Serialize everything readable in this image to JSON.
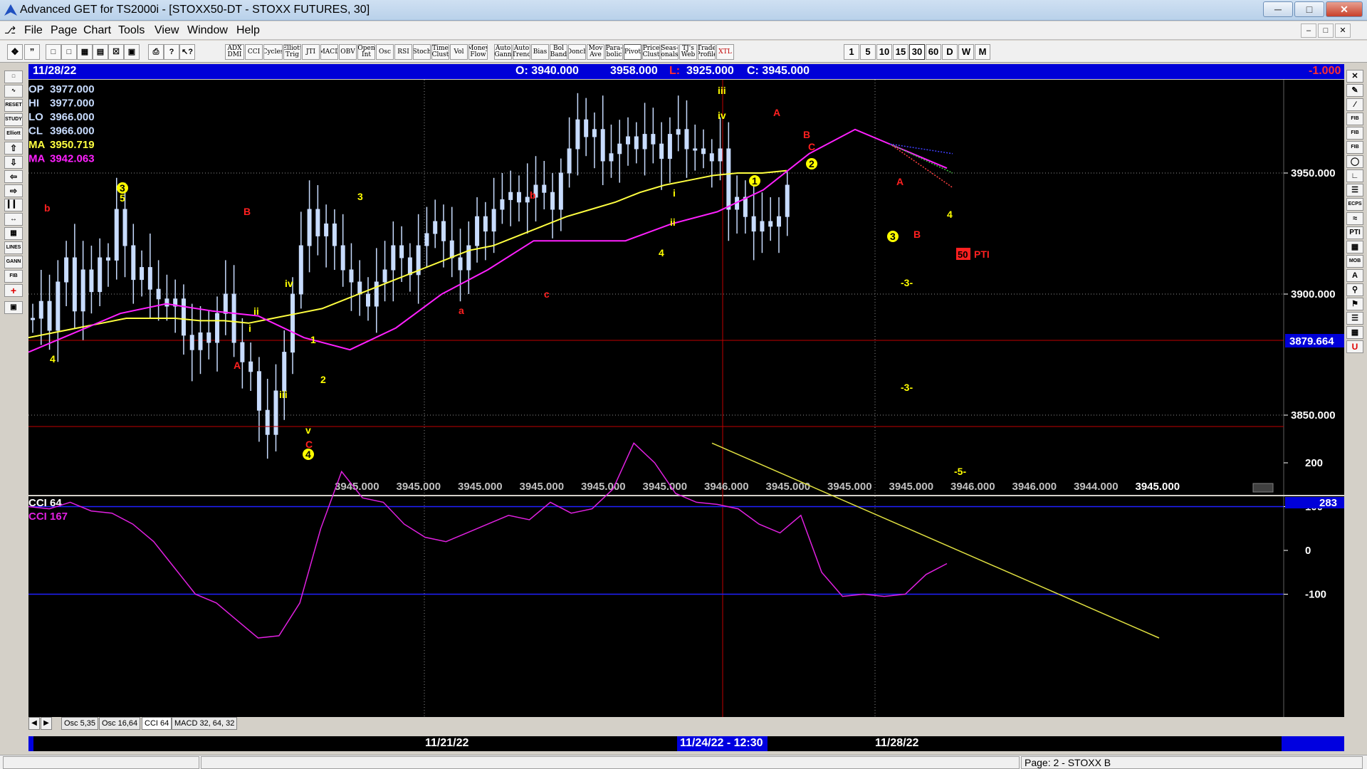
{
  "window": {
    "title": "Advanced GET for TS2000i - [STOXX50-DT - STOXX FUTURES, 30]"
  },
  "menu": [
    "File",
    "Page",
    "Chart",
    "Tools",
    "View",
    "Window",
    "Help"
  ],
  "toolbar": {
    "studies": [
      "ADX DMI",
      "CCI",
      "Cycles",
      "Elliott Trig",
      "JTI",
      "MACD",
      "OBV",
      "Open Int",
      "Osc",
      "RSI",
      "Stoch",
      "Time Clust",
      "Vol",
      "Money Flow",
      "Auto Gann",
      "Auto Trend",
      "Bias",
      "Bol Band",
      "Donch",
      "Mov Ave",
      "Para-bolic",
      "Pivot",
      "Price Clust",
      "Seas-onals",
      "TJ's Web",
      "Trade Profile",
      "XTL"
    ],
    "timeframes": [
      "1",
      "5",
      "10",
      "15",
      "30",
      "60",
      "D",
      "W",
      "M"
    ],
    "active_timeframe": "30"
  },
  "left_tools": [
    "RESET",
    "STUDY",
    "Elliott",
    "LINES",
    "GANN",
    "FIB"
  ],
  "right_tools": [
    "FIB RET",
    "FIB EXT",
    "FIB TIME",
    "ECPS",
    "PTI",
    "MOB",
    "U"
  ],
  "header": {
    "date": "11/28/22",
    "open": "O: 3940.000",
    "high": "3958.000",
    "low_label": "L:",
    "low": "3925.000",
    "close": "C: 3945.000",
    "change": "-1.000"
  },
  "readout": [
    {
      "label": "OP",
      "value": "3977.000"
    },
    {
      "label": "HI",
      "value": "3977.000"
    },
    {
      "label": "LO",
      "value": "3966.000"
    },
    {
      "label": "CL",
      "value": "3966.000"
    },
    {
      "label": "MA",
      "value": "3950.719"
    },
    {
      "label": "MA",
      "value": "3942.063"
    }
  ],
  "price_axis": {
    "ticks": [
      "3950.000",
      "3900.000",
      "3850.000"
    ],
    "cursor_price": "3879.664"
  },
  "bottom_values": [
    "3945.000",
    "3945.000",
    "3945.000",
    "3945.000",
    "3945.000",
    "3945.000",
    "3946.000",
    "3945.000",
    "3945.000",
    "3945.000",
    "3946.000",
    "3946.000",
    "3944.000",
    "3945.000"
  ],
  "indicator": {
    "title1": "CCI 64",
    "title2": "CCI  167",
    "value": "283",
    "ticks": [
      "200",
      "100",
      "0",
      "-100"
    ]
  },
  "tabs": [
    "Osc 5,35",
    "Osc 16,64",
    "CCI 64",
    "MACD 32, 64, 32"
  ],
  "active_tab": "CCI 64",
  "dates": [
    "11/21/22",
    "11/24/22 - 12:30",
    "11/28/22"
  ],
  "status": {
    "page": "Page: 2 - STOXX B"
  },
  "colors": {
    "bg": "#000000",
    "candle": "#c8dcff",
    "ma_fast": "#ffff40",
    "ma_slow": "#ff20ff",
    "bull_label": "#ffff00",
    "bear_label": "#ff2020",
    "header": "#0000d8",
    "cci": "#e020e0",
    "trendline": "#e0e040"
  },
  "chart_data": {
    "type": "candlestick",
    "title": "STOXX50-DT - STOXX FUTURES, 30",
    "ylim": [
      3810,
      3985
    ],
    "close_series": [
      3890,
      3897,
      3885,
      3905,
      3915,
      3893,
      3910,
      3901,
      3915,
      3914,
      3935,
      3920,
      3906,
      3911,
      3902,
      3898,
      3895,
      3898,
      3883,
      3877,
      3884,
      3880,
      3892,
      3900,
      3880,
      3872,
      3868,
      3852,
      3842,
      3860,
      3876,
      3900,
      3920,
      3935,
      3924,
      3929,
      3920,
      3910,
      3905,
      3900,
      3895,
      3905,
      3910,
      3920,
      3915,
      3908,
      3920,
      3925,
      3930,
      3922,
      3915,
      3910,
      3920,
      3932,
      3926,
      3935,
      3939,
      3942,
      3938,
      3940,
      3945,
      3942,
      3935,
      3950,
      3960,
      3972,
      3965,
      3968,
      3955,
      3958,
      3962,
      3965,
      3960,
      3966,
      3962,
      3956,
      3966,
      3968,
      3960,
      3960,
      3958,
      3955,
      3960,
      3935,
      3940,
      3932,
      3926,
      3930,
      3928,
      3932,
      3945
    ],
    "ma_fast": [
      3882,
      3884,
      3886,
      3888,
      3890,
      3890,
      3890,
      3889,
      3889,
      3888,
      3890,
      3892,
      3894,
      3898,
      3902,
      3906,
      3910,
      3914,
      3918,
      3920,
      3924,
      3928,
      3932,
      3935,
      3938,
      3942,
      3945,
      3947,
      3949,
      3950,
      3950,
      3951
    ],
    "ma_slow": [
      3876,
      3884,
      3892,
      3896,
      3893,
      3891,
      3882,
      3877,
      3886,
      3900,
      3910,
      3922,
      3922,
      3922,
      3929,
      3934,
      3943,
      3958,
      3968,
      3960,
      3952
    ],
    "cci": [
      100,
      95,
      110,
      90,
      85,
      60,
      20,
      -40,
      -100,
      -120,
      -160,
      -200,
      -195,
      -120,
      50,
      180,
      120,
      110,
      60,
      30,
      20,
      40,
      60,
      80,
      70,
      110,
      85,
      95,
      140,
      245,
      200,
      130,
      110,
      105,
      95,
      60,
      40,
      80,
      -50,
      -105,
      -100,
      -105,
      -100,
      -55,
      -30
    ],
    "waves": [
      {
        "label": "b",
        "color": "bear"
      },
      {
        "label": "3",
        "color": "bull"
      },
      {
        "label": "5",
        "color": "bull"
      },
      {
        "label": "4",
        "color": "bull"
      },
      {
        "label": "B",
        "color": "bear"
      },
      {
        "label": "A",
        "color": "bear"
      },
      {
        "label": "ii",
        "color": "bull"
      },
      {
        "label": "i",
        "color": "bull"
      },
      {
        "label": "iv",
        "color": "bull"
      },
      {
        "label": "iii",
        "color": "bull"
      },
      {
        "label": "1",
        "color": "bull"
      },
      {
        "label": "2",
        "color": "bull"
      },
      {
        "label": "v",
        "color": "bull"
      },
      {
        "label": "C",
        "color": "bear"
      },
      {
        "label": "4",
        "color": "bull"
      },
      {
        "label": "3",
        "color": "bull"
      },
      {
        "label": "b",
        "color": "bear"
      },
      {
        "label": "a",
        "color": "bear"
      },
      {
        "label": "c",
        "color": "bear"
      },
      {
        "label": "i",
        "color": "bull"
      },
      {
        "label": "ii",
        "color": "bull"
      },
      {
        "label": "4",
        "color": "bull"
      },
      {
        "label": "iii",
        "color": "bull"
      },
      {
        "label": "iv",
        "color": "bull"
      },
      {
        "label": "A",
        "color": "bear"
      },
      {
        "label": "1",
        "color": "bull"
      },
      {
        "label": "2",
        "color": "bull"
      },
      {
        "label": "C",
        "color": "bear"
      },
      {
        "label": "B",
        "color": "bear"
      },
      {
        "label": "A",
        "color": "bear"
      },
      {
        "label": "3",
        "color": "bull"
      },
      {
        "label": "B",
        "color": "bear"
      },
      {
        "label": "4",
        "color": "bull"
      },
      {
        "label": "-3-",
        "color": "bull"
      },
      {
        "label": "-3-",
        "color": "bull"
      },
      {
        "label": "-5-",
        "color": "bull"
      }
    ],
    "pti": {
      "value": "50",
      "label": "PTI"
    }
  }
}
